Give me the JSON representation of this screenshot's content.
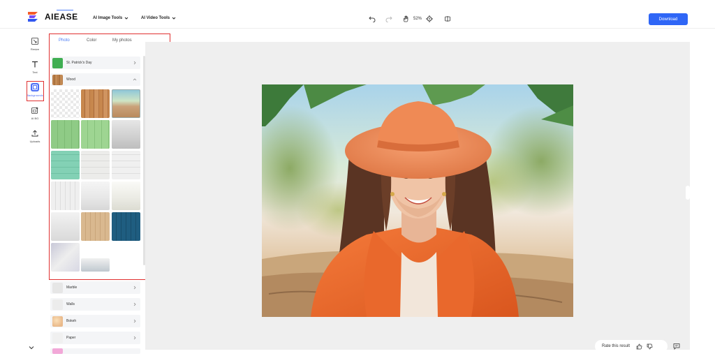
{
  "header": {
    "logo_text": "AIEASE",
    "menu_image": "AI Image Tools",
    "menu_video": "AI Video Tools",
    "zoom": "52%",
    "download_label": "Download"
  },
  "rail": {
    "items": [
      {
        "label": "Resize",
        "icon": "resize-icon"
      },
      {
        "label": "Text",
        "icon": "text-icon"
      },
      {
        "label": "Backgrounds",
        "icon": "backgrounds-icon"
      },
      {
        "label": "AI BG",
        "icon": "ai-bg-icon"
      },
      {
        "label": "Uploads",
        "icon": "upload-icon"
      }
    ]
  },
  "panel": {
    "tabs": [
      "Photo",
      "Color",
      "My photos"
    ],
    "active_tab": "Photo",
    "categories": {
      "st_patricks": "St. Patrick's Day",
      "wood": "Wood",
      "marble": "Marble",
      "walls": "Walls",
      "bokeh": "Bokeh",
      "paper": "Paper"
    }
  },
  "footer": {
    "rate_text": "Rate this result"
  },
  "colors": {
    "accent": "#2f66f6",
    "highlight": "#e03030",
    "active_tab": "#4c7cf5"
  }
}
